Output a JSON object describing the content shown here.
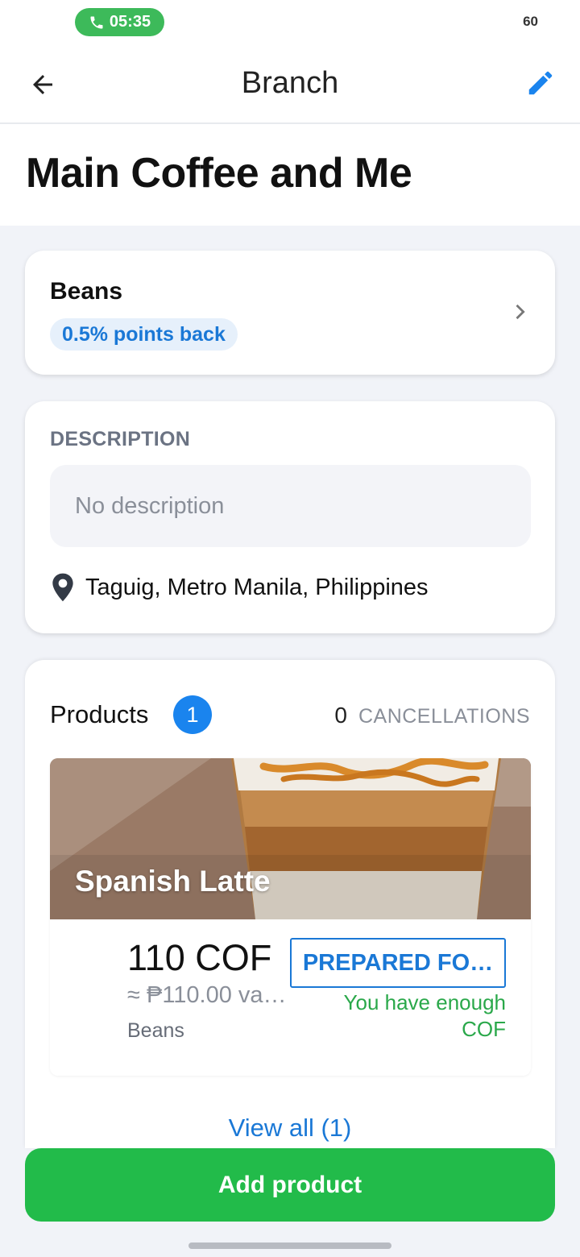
{
  "status_bar": {
    "time": "05:35",
    "battery": "60"
  },
  "app_bar": {
    "title": "Branch",
    "back_icon": "arrow-left-icon",
    "edit_icon": "pencil-icon"
  },
  "page": {
    "title": "Main Coffee and Me"
  },
  "beans_card": {
    "title": "Beans",
    "badge": "0.5% points back"
  },
  "description_card": {
    "label": "DESCRIPTION",
    "placeholder": "No description",
    "location": "Taguig, Metro Manila, Philippines"
  },
  "products_card": {
    "label": "Products",
    "count": "1",
    "cancellations_count": "0",
    "cancellations_label": "CANCELLATIONS",
    "items": [
      {
        "name": "Spanish Latte",
        "price": "110 COF",
        "peso_value": "≈ ₱110.00 va…",
        "currency": "Beans",
        "action_label": "PREPARED FO…",
        "status": "You have enough COF"
      }
    ],
    "view_all": "View all (1)"
  },
  "footer": {
    "add_product": "Add product"
  },
  "colors": {
    "accent_blue": "#1a78d6",
    "primary_green": "#22bb4a",
    "status_green": "#2aa84a",
    "call_pill_green": "#3dba5a"
  }
}
